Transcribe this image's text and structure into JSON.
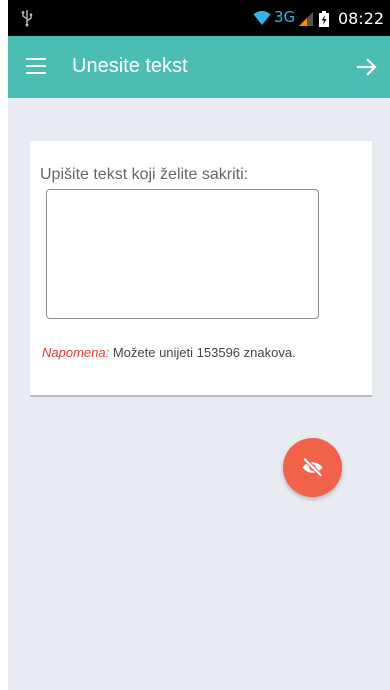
{
  "status_bar": {
    "network": "3G",
    "time": "08:22",
    "icons": [
      "usb-icon",
      "wifi-icon",
      "signal-icon",
      "battery-icon"
    ]
  },
  "app_bar": {
    "title": "Unesite tekst",
    "menu_icon": "hamburger-menu-icon",
    "next_icon": "arrow-right-icon",
    "color": "#4cbdb3"
  },
  "card": {
    "label": "Upišite tekst koji želite sakriti:",
    "text_value": "",
    "note_label": "Napomena:",
    "note_text": " Možete unijeti 153596 znakova."
  },
  "fab": {
    "icon": "eye-off-icon",
    "color": "#f2614a"
  }
}
